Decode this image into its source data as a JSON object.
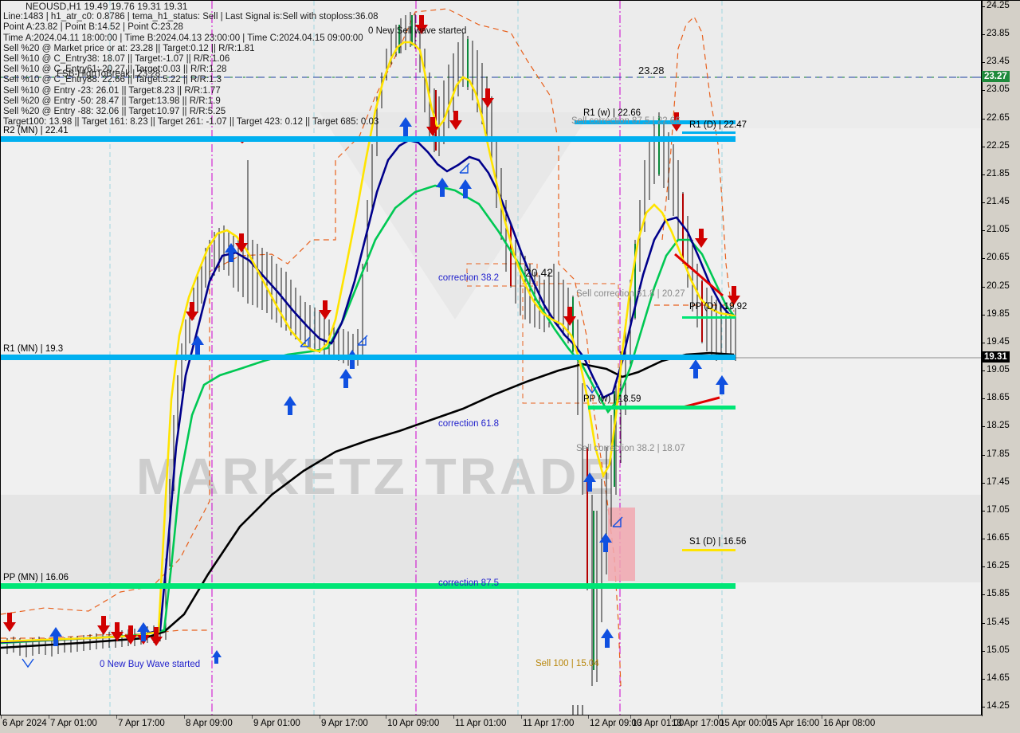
{
  "header": {
    "symbol_line": "NEOUSD,H1  19.49 19.76 19.31 19.31",
    "lines": [
      "Line:1483 | h1_atr_c0: 0.8786 | tema_h1_status: Sell | Last Signal is:Sell with stoploss:36.08",
      "Point A:23.82 | Point B:14.52 | Point C:23.28",
      "Time A:2024.04.11 18:00:00 | Time B:2024.04.13 23:00:00 | Time C:2024.04.15 09:00:00",
      "Sell %20 @ Market price or at: 23.28 || Target:0.12 || R/R:1.81",
      "Sell %10 @ C_Entry38: 18.07 || Target:-1.07 || R/R:1.06",
      "Sell %10 @ C_Entry61: 20.27 || Target:0.03 || R/R:1.28",
      "Sell %10 @ C_Entry88: 22.66 || Target:5.22 || R/R:1.3",
      "Sell %10 @ Entry -23: 26.01 || Target:8.23 || R/R:1.77",
      "Sell %20 @ Entry -50: 28.47 || Target:13.98 || R/R:1.9",
      "Sell %20 @ Entry -88: 32.06 || Target:10.97 || R/R:5.25",
      "Target100: 13.98 || Target 161: 8.23 || Target 261: -1.07 || Target 423: 0.12 || Target 685: 0.03"
    ],
    "overlay_label": "FSB-HighToBreak | 23.28"
  },
  "chart_data": {
    "type": "line",
    "title": "NEOUSD,H1",
    "xlabel": "",
    "ylabel": "",
    "grid": false,
    "legend_position": "none",
    "ylim": [
      14.25,
      24.25
    ],
    "y_ticks": [
      "24.25",
      "23.85",
      "23.45",
      "23.05",
      "22.65",
      "22.25",
      "21.85",
      "21.45",
      "21.05",
      "20.65",
      "20.25",
      "19.85",
      "19.45",
      "19.05",
      "18.65",
      "18.25",
      "17.85",
      "17.45",
      "17.05",
      "16.65",
      "16.25",
      "15.85",
      "15.45",
      "15.05",
      "14.65",
      "14.25"
    ],
    "x_ticks": [
      "6 Apr 2024",
      "7 Apr 01:00",
      "7 Apr 17:00",
      "8 Apr 09:00",
      "9 Apr 01:00",
      "9 Apr 17:00",
      "10 Apr 09:00",
      "11 Apr 01:00",
      "11 Apr 17:00",
      "12 Apr 09:00",
      "13 Apr 01:00",
      "13 Apr 17:00",
      "15 Apr 00:00",
      "15 Apr 16:00",
      "16 Apr 08:00"
    ],
    "price_tags": [
      {
        "value": "23.27",
        "style": "green"
      },
      {
        "value": "19.31",
        "style": "black"
      }
    ],
    "ohlc_current": {
      "open": "19.49",
      "high": "19.76",
      "low": "19.31",
      "close": "19.31"
    },
    "series": [
      {
        "name": "tema-fast-yellow",
        "color": "#ffe400"
      },
      {
        "name": "tema-mid-navy",
        "color": "#00008b"
      },
      {
        "name": "tema-slow-green",
        "color": "#00c853"
      },
      {
        "name": "tema-base-black",
        "color": "#000000"
      },
      {
        "name": "channel-dashed-orange",
        "color": "#e8601c"
      }
    ]
  },
  "levels": [
    {
      "name": "R2 (MN)",
      "label": "R2 (MN) | 22.41",
      "color": "#00b0f0",
      "side": "left"
    },
    {
      "name": "R1 (MN)",
      "label": "R1 (MN) | 19.3",
      "color": "#00b0f0",
      "side": "left"
    },
    {
      "name": "PP (MN)",
      "label": "PP (MN) | 16.06",
      "color": "#00e676",
      "side": "left"
    },
    {
      "name": "R1 (w)",
      "label": "R1 (w) | 22.66",
      "color": "#00b0f0",
      "side": "mid"
    },
    {
      "name": "R1 (D)",
      "label": "R1 (D) | 22.47",
      "color": "#00b0f0",
      "side": "right"
    },
    {
      "name": "PP (D)",
      "label": "PP (D) | 19.92",
      "color": "#00e676",
      "side": "right"
    },
    {
      "name": "PP (w)",
      "label": "PP (w) | 18.59",
      "color": "#00e676",
      "side": "right"
    },
    {
      "name": "S1 (D)",
      "label": "S1 (D) | 16.56",
      "color": "#ffe400",
      "side": "right"
    }
  ],
  "annotations": [
    {
      "name": "new-sell-wave",
      "text": "0 New Sell wave started",
      "color": "#000000"
    },
    {
      "name": "new-buy-wave",
      "text": "0 New Buy Wave started",
      "color": "#2222cc"
    },
    {
      "name": "high-to-break",
      "text": "23.28",
      "color": "#000000"
    },
    {
      "name": "correction-38-2",
      "text": "correction 38.2",
      "color": "#2222cc"
    },
    {
      "name": "correction-61-8",
      "text": "correction 61.8",
      "color": "#2222cc"
    },
    {
      "name": "correction-87-5",
      "text": "correction 87.5",
      "color": "#2222cc"
    },
    {
      "name": "fib-20-42",
      "text": "20.42",
      "color": "#000000"
    },
    {
      "name": "sell-correction-87-5",
      "text": "Sell correction 87.5 | 22.66",
      "color": "#808080"
    },
    {
      "name": "sell-correction-61-8",
      "text": "Sell correction 61.8 | 20.27",
      "color": "#808080"
    },
    {
      "name": "sell-correction-38-2",
      "text": "Sell correction 38.2 | 18.07",
      "color": "#808080"
    },
    {
      "name": "sell-100",
      "text": "Sell 100 | 15.04",
      "color": "#b8860b"
    }
  ]
}
